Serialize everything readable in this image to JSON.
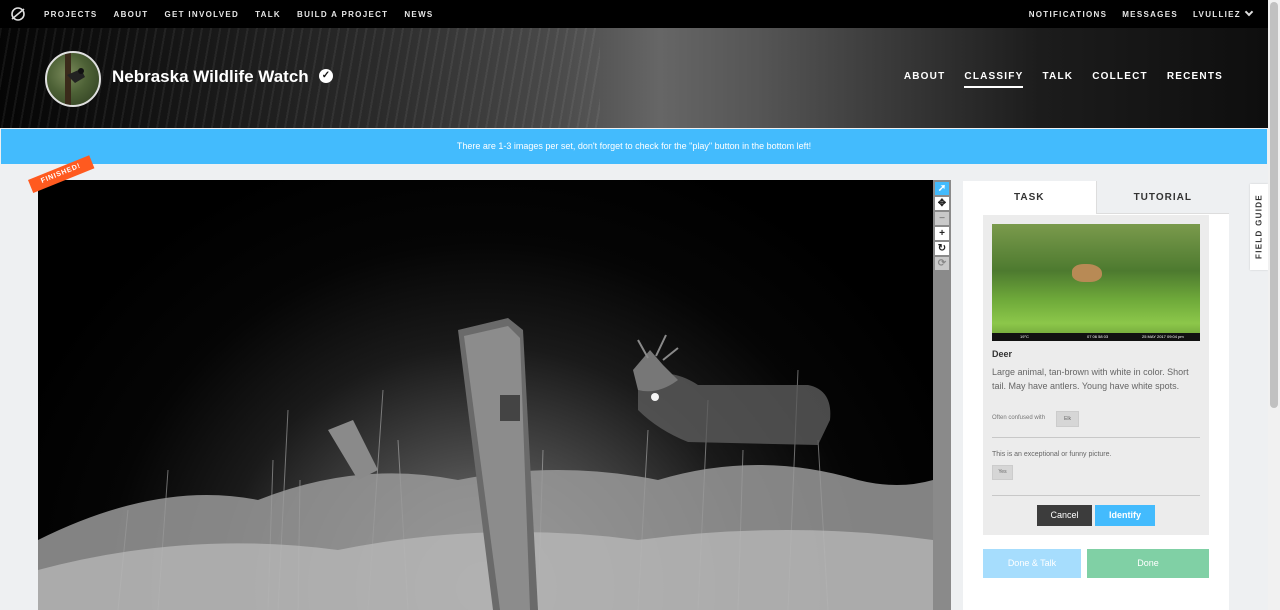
{
  "topnav": {
    "logo_icon": "zooniverse-logo-icon",
    "links": [
      "PROJECTS",
      "ABOUT",
      "GET INVOLVED",
      "TALK",
      "BUILD A PROJECT",
      "NEWS"
    ],
    "right": [
      "NOTIFICATIONS",
      "MESSAGES",
      "LVULLIEZ"
    ]
  },
  "project": {
    "title": "Nebraska Wildlife Watch",
    "nav": [
      "ABOUT",
      "CLASSIFY",
      "TALK",
      "COLLECT",
      "RECENTS"
    ],
    "active_nav": "CLASSIFY"
  },
  "banner": "There are 1-3 images per set, don't forget to check for the \"play\" button in the bottom left!",
  "subject": {
    "badge": "FINISHED!"
  },
  "toolbar": {
    "tools": [
      "pointer-icon",
      "pan-icon",
      "zoom-out-icon",
      "zoom-in-icon",
      "rotate-icon",
      "reset-icon"
    ]
  },
  "panel": {
    "tabs": [
      "TASK",
      "TUTORIAL"
    ],
    "choice": {
      "name": "Deer",
      "description": "Large animal, tan-brown with white in color. Short tail. May have antlers. Young have white spots.",
      "confused_label": "Often confused with",
      "confused_with": "Elk",
      "question": "This is an exceptional or funny picture.",
      "answer": "Yes",
      "thumb_stamp_left": "19°C",
      "thumb_stamp_mid": "07 06 58 03",
      "thumb_stamp_right": "25 MAY 2017  09:04 pm"
    },
    "cancel_label": "Cancel",
    "identify_label": "Identify",
    "done_talk_label": "Done & Talk",
    "done_label": "Done"
  },
  "field_guide": "FIELD GUIDE",
  "colors": {
    "accent": "#43bbfd",
    "done": "#80d0a5",
    "badge": "#ff5a1f"
  }
}
